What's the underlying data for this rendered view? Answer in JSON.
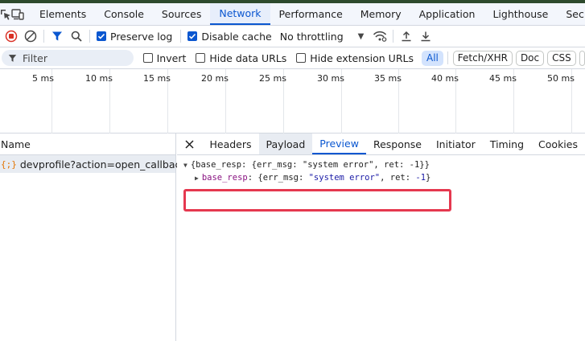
{
  "tabs": [
    "Elements",
    "Console",
    "Sources",
    "Network",
    "Performance",
    "Memory",
    "Application",
    "Lighthouse",
    "Sec"
  ],
  "active_tab": "Network",
  "toolbar": {
    "preserve_log": "Preserve log",
    "disable_cache": "Disable cache",
    "throttling": "No throttling"
  },
  "filter": {
    "placeholder": "Filter",
    "invert": "Invert",
    "hide_data_urls": "Hide data URLs",
    "hide_extension_urls": "Hide extension URLs",
    "types": [
      "All",
      "Fetch/XHR",
      "Doc",
      "CSS"
    ]
  },
  "timeline": {
    "ticks": [
      "5 ms",
      "10 ms",
      "15 ms",
      "20 ms",
      "25 ms",
      "30 ms",
      "35 ms",
      "40 ms",
      "45 ms",
      "50 ms"
    ]
  },
  "requests": {
    "column_name": "Name",
    "items": [
      {
        "icon": "{;}",
        "name": "devprofile?action=open_callback"
      }
    ]
  },
  "details": {
    "tabs": [
      "Headers",
      "Payload",
      "Preview",
      "Response",
      "Initiator",
      "Timing",
      "Cookies"
    ],
    "active": "Preview",
    "hovered": "Payload"
  },
  "preview": {
    "root_text": "{base_resp: {err_msg: \"system error\", ret: -1}}",
    "child_key": "base_resp",
    "child_sep": ": ",
    "child_open": "{err_msg: ",
    "child_str": "\"system error\"",
    "child_mid": ", ret: ",
    "child_num": "-1",
    "child_close": "}"
  },
  "colors": {
    "accent": "#0b57d0",
    "highlight_box": "#e5384f",
    "record_red": "#d93025"
  }
}
